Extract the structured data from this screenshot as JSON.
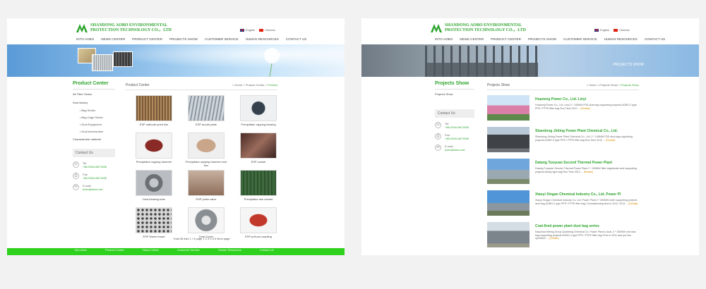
{
  "header": {
    "company": "SHANDONG AOBO ENVIRONMENTAL\nPROTECTION TECHNOLOGY CO.，LTD",
    "lang_en": "English",
    "lang_cn": "Chinese"
  },
  "nav": [
    "INTO AOBO",
    "NEWS CENTER",
    "PRODUCT CENTER",
    "PROJECTS SHOW",
    "CUSTOMER SERVICE",
    "HUMAN RESOURCES",
    "CONTACT US"
  ],
  "left": {
    "side_title": "Product Center",
    "side_items": [
      "Air Filter Series",
      "Dust factory"
    ],
    "side_subs": [
      "Bag Series",
      "Bag Cage Series",
      "Dust Equipment",
      "Dust Accessories"
    ],
    "side_extra": "Characteristic material",
    "contact_head": "Contact Us",
    "tel_label": "Tel:",
    "tel": "+86-0534-8671556",
    "fax_label": "Fax:",
    "fax": "+86-0534-8671556",
    "email_label": "E-mail:",
    "email": "aobo@aobo.net",
    "crumb_title": "Product Center",
    "crumb": "Home > Product Center > ",
    "crumb_current": "Product",
    "products": [
      {
        "caption": "ESP cathode point line"
      },
      {
        "caption": "ESP anode plate"
      },
      {
        "caption": "Precipitator rapping bearing"
      },
      {
        "caption": "Precipitator rapping hammer"
      },
      {
        "caption": "Precipitator rapping hammer lock box"
      },
      {
        "caption": "ESP cocket"
      },
      {
        "caption": "Dust blowing tube"
      },
      {
        "caption": "ESP pulse valve"
      },
      {
        "caption": "Precipitator ash bucket"
      },
      {
        "caption": "ESP flower board"
      },
      {
        "caption": "Dust Cover"
      },
      {
        "caption": "ESP pull pin coupling"
      }
    ],
    "pager": "Total 36 lists 1 / 4 page  1 2 3 4 5 6 Next page",
    "footer": [
      "Into Aobo",
      "Product Center",
      "News Center",
      "Customer Service",
      "Human Resources",
      "Contact Us"
    ]
  },
  "right": {
    "banner_text": "PROJECTS SHOW",
    "side_title": "Projects Show",
    "side_item": "Projects Show",
    "contact_head": "Contact Us",
    "tel_label": "Tel:",
    "tel": "+86-0534-8671556",
    "fax_label": "Fax:",
    "fax": "+86-0534-8671556",
    "email_label": "E-mail:",
    "email": "aobo@aobo.net",
    "crumb_title": "Projects Show",
    "crumb": "Home > Projects Show > ",
    "crumb_current": "Projects Show",
    "projects": [
      {
        "title": "Huaneng Power Co., Ltd. Linyi",
        "desc": "Huaneng Power Co., Ltd. Linyi 2 * 140MW P3D dust bag supporting projects AOBO-2 type PPS / PTFE filter bag Run Time 2012 ...",
        "more": "[Details]"
      },
      {
        "title": "Shandong Jinling Power Plant Chemical Co., Ltd.",
        "desc": "Shandong Jinling Power Plant Chemical Co., Ltd. 2 * 145MW P3D dust bag supporting projects AOBO-2 type PPS / PTFE filter bag Run Time 2012 ...",
        "more": "[Details]"
      },
      {
        "title": "Datang Tuoyuan Second Thermal Power Plant",
        "desc": "Datang Tuoyuan Second Thermal Power Plant 2 * 300MW filter bag/cluster and supporting projects Aboby type bag Run Time 2012 ...",
        "more": "[Details]"
      },
      {
        "title": "Xiaoyi Xingan Chemical Industry Co., Ltd. Power Pl",
        "desc": "Xiaoyi Xingan Chemical Industry Co. Ltd. Power Plant 2 * 300MW cloth supporting projects dust bag AOBO-2 type PPS / PTFE filter bag Commissioning time in 2012, 2013 ...",
        "more": "[Details]"
      },
      {
        "title": "Coal-fired power plant dust bag series",
        "desc": "Kaiyuhua Mining Group Qualitong Chemical Co. Power Plant & dual, 2 * 300MW unit dust bag supporting projects AOBO-2 type PPS / PTFE filter bag Time in 2011 and put into operation ...",
        "more": "[Details]"
      }
    ]
  },
  "colors": {
    "brand_green": "#2fa52f",
    "footer_green": "#2fd11f",
    "link_orange": "#d98c00"
  }
}
